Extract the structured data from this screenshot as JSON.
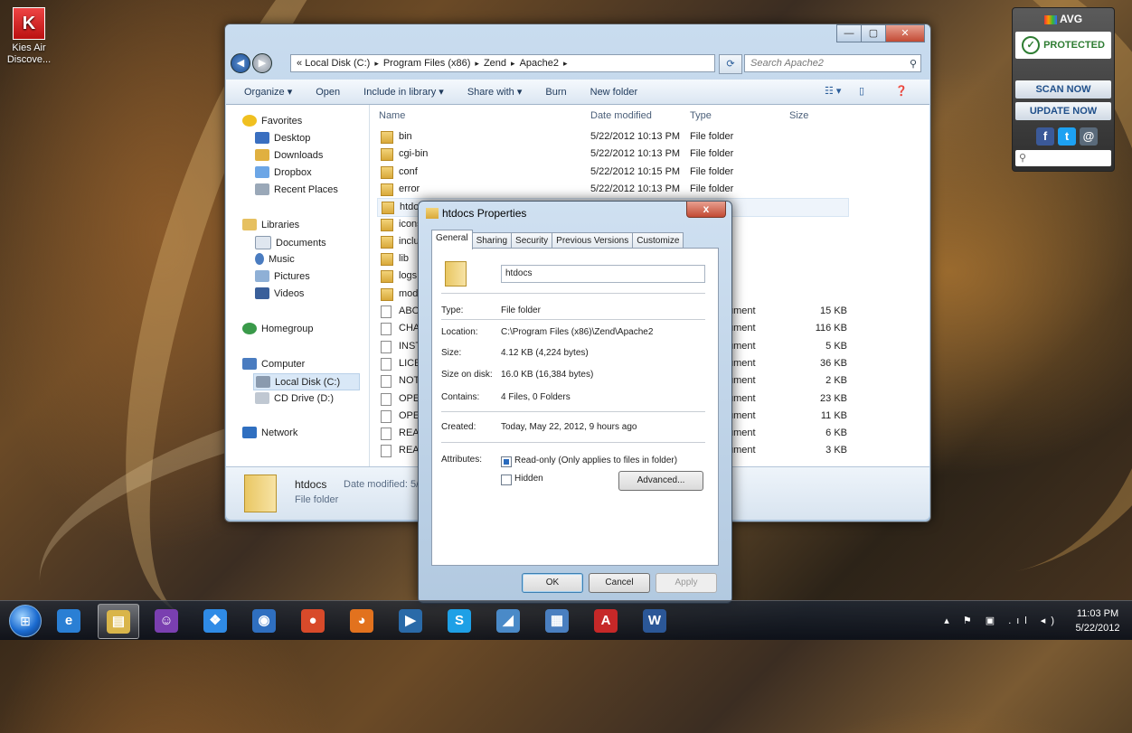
{
  "desktop": {
    "icon_label": "Kies Air Discove...",
    "icon_glyph": "K"
  },
  "explorer": {
    "window_buttons": {
      "minimize": "—",
      "maximize": "▢",
      "close": "✕"
    },
    "address": {
      "overflow": "«",
      "crumbs": [
        "Local Disk (C:)",
        "Program Files (x86)",
        "Zend",
        "Apache2"
      ],
      "separator": "▸"
    },
    "search_placeholder": "Search Apache2",
    "toolbar": [
      "Organize ▾",
      "Open",
      "Include in library ▾",
      "Share with ▾",
      "Burn",
      "New folder"
    ],
    "nav": {
      "favorites": "Favorites",
      "desktop": "Desktop",
      "downloads": "Downloads",
      "dropbox": "Dropbox",
      "recent": "Recent Places",
      "libraries": "Libraries",
      "documents": "Documents",
      "music": "Music",
      "pictures": "Pictures",
      "videos": "Videos",
      "homegroup": "Homegroup",
      "computer": "Computer",
      "local_disk": "Local Disk (C:)",
      "cd_drive": "CD Drive (D:)",
      "network": "Network"
    },
    "columns": {
      "name": "Name",
      "date": "Date modified",
      "type": "Type",
      "size": "Size"
    },
    "rows": [
      {
        "name": "bin",
        "date": "5/22/2012 10:13 PM",
        "type": "File folder",
        "size": ""
      },
      {
        "name": "cgi-bin",
        "date": "5/22/2012 10:13 PM",
        "type": "File folder",
        "size": ""
      },
      {
        "name": "conf",
        "date": "5/22/2012 10:15 PM",
        "type": "File folder",
        "size": ""
      },
      {
        "name": "error",
        "date": "5/22/2012 10:13 PM",
        "type": "File folder",
        "size": ""
      },
      {
        "name": "htdoc",
        "date": "",
        "type": "r",
        "size": ""
      },
      {
        "name": "icons",
        "date": "",
        "type": "r",
        "size": ""
      },
      {
        "name": "inclu",
        "date": "",
        "type": "r",
        "size": ""
      },
      {
        "name": "lib",
        "date": "",
        "type": "r",
        "size": ""
      },
      {
        "name": "logs",
        "date": "",
        "type": "r",
        "size": ""
      },
      {
        "name": "modu",
        "date": "",
        "type": "r",
        "size": ""
      },
      {
        "name": "ABOU",
        "date": "",
        "type": "ument",
        "size": "15 KB"
      },
      {
        "name": "CHAN",
        "date": "",
        "type": "ument",
        "size": "116 KB"
      },
      {
        "name": "INSTA",
        "date": "",
        "type": "ument",
        "size": "5 KB"
      },
      {
        "name": "LICEN",
        "date": "",
        "type": "ument",
        "size": "36 KB"
      },
      {
        "name": "NOTI",
        "date": "",
        "type": "ument",
        "size": "2 KB"
      },
      {
        "name": "OPEN",
        "date": "",
        "type": "ument",
        "size": "23 KB"
      },
      {
        "name": "OPEN",
        "date": "",
        "type": "ument",
        "size": "11 KB"
      },
      {
        "name": "READ",
        "date": "",
        "type": "ument",
        "size": "6 KB"
      },
      {
        "name": "READ",
        "date": "",
        "type": "ument",
        "size": "3 KB"
      }
    ],
    "details": {
      "name": "htdocs",
      "date_label": "Date modified: 5/",
      "type": "File folder"
    }
  },
  "properties": {
    "title": "htdocs Properties",
    "close": "x",
    "tabs": [
      "General",
      "Sharing",
      "Security",
      "Previous Versions",
      "Customize"
    ],
    "folder_name": "htdocs",
    "fields": [
      {
        "label": "Type:",
        "value": "File folder"
      },
      {
        "label": "Location:",
        "value": "C:\\Program Files (x86)\\Zend\\Apache2"
      },
      {
        "label": "Size:",
        "value": "4.12 KB (4,224 bytes)"
      },
      {
        "label": "Size on disk:",
        "value": "16.0 KB (16,384 bytes)"
      },
      {
        "label": "Contains:",
        "value": "4 Files, 0 Folders"
      },
      {
        "label": "Created:",
        "value": "Today, May 22, 2012, 9 hours ago"
      }
    ],
    "attributes_label": "Attributes:",
    "readonly": "Read-only (Only applies to files in folder)",
    "hidden": "Hidden",
    "advanced": "Advanced...",
    "ok": "OK",
    "cancel": "Cancel",
    "apply": "Apply"
  },
  "avg": {
    "brand": "AVG",
    "status": "PROTECTED",
    "scan": "SCAN NOW",
    "update": "UPDATE NOW",
    "search_icon": "⚲"
  },
  "taskbar": {
    "start_glyph": "⊞",
    "apps": [
      {
        "glyph": "e",
        "color": "#2a7fd4"
      },
      {
        "glyph": "▤",
        "color": "#d9b54a"
      },
      {
        "glyph": "☺",
        "color": "#7a3fb0"
      },
      {
        "glyph": "❖",
        "color": "#2f8be6"
      },
      {
        "glyph": "◉",
        "color": "#2f6fc0"
      },
      {
        "glyph": "●",
        "color": "#d84a2a"
      },
      {
        "glyph": "◕",
        "color": "#e2721e"
      },
      {
        "glyph": "▶",
        "color": "#2a6aa8"
      },
      {
        "glyph": "S",
        "color": "#1ea0e6"
      },
      {
        "glyph": "◢",
        "color": "#4a8ac8"
      },
      {
        "glyph": "▦",
        "color": "#4a7fc0"
      },
      {
        "glyph": "A",
        "color": "#c62828"
      },
      {
        "glyph": "W",
        "color": "#2b5797"
      }
    ],
    "tray_icons": "▴ ⚑ ▣ .ıl ◂)",
    "time": "11:03 PM",
    "date": "5/22/2012"
  }
}
